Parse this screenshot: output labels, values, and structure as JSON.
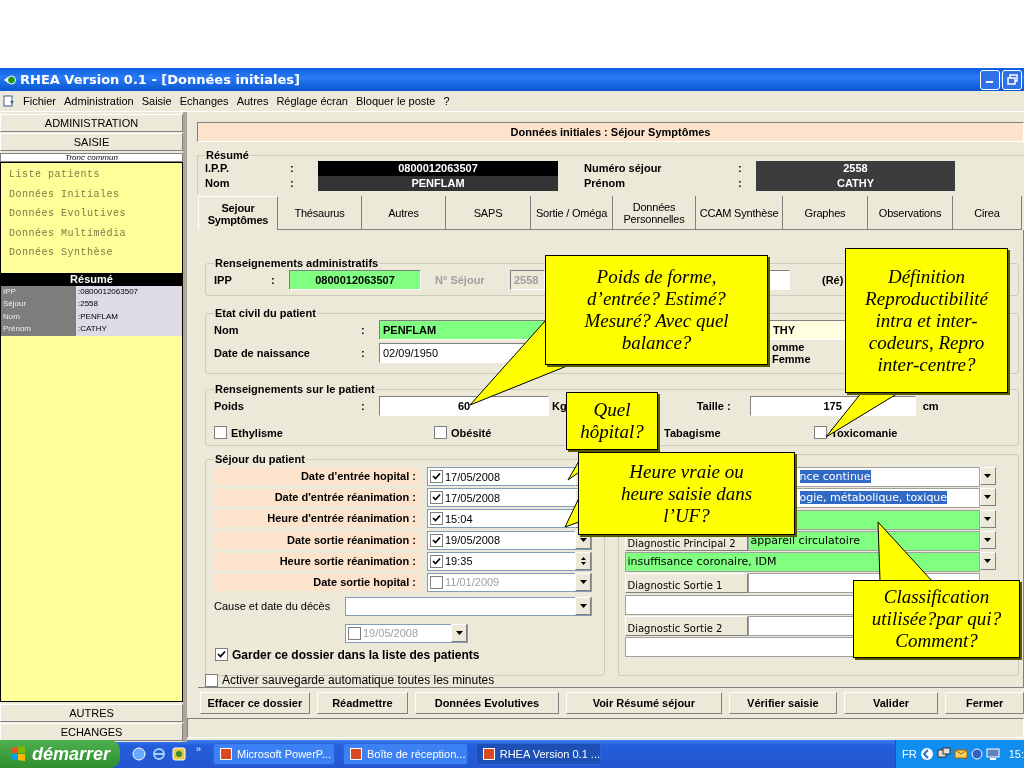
{
  "window": {
    "title": "RHEA Version 0.1 - [Données initiales]"
  },
  "menu": [
    "Fichier",
    "Administration",
    "Saisie",
    "Echanges",
    "Autres",
    "Réglage écran",
    "Bloquer le poste",
    "?"
  ],
  "sidebar": {
    "top_sections": [
      "ADMINISTRATION",
      "SAISIE"
    ],
    "group": "Tronc commun",
    "items": [
      "Liste patients",
      "Données Initiales",
      "Données Evolutives",
      "Données Multimédia",
      "Données Synthèse"
    ],
    "summary": {
      "title": "Résumé",
      "rows": [
        {
          "label": "IPP",
          "value": ":0800012063507"
        },
        {
          "label": "Séjour",
          "value": ":2558"
        },
        {
          "label": "Nom",
          "value": ":PENFLAM"
        },
        {
          "label": "Prénom",
          "value": ":CATHY"
        }
      ]
    },
    "bottom_sections": [
      "AUTRES",
      "ECHANGES"
    ]
  },
  "header": {
    "title": "Données initiales : Séjour Symptômes"
  },
  "summary": {
    "title": "Résumé",
    "fields": [
      {
        "label": "I.P.P.",
        "sep": ":",
        "value": "0800012063507"
      },
      {
        "label": "Nom",
        "sep": ":",
        "value": "PENFLAM"
      },
      {
        "label": "Numéro séjour",
        "sep": ":",
        "value": "2558"
      },
      {
        "label": "Prénom",
        "sep": ":",
        "value": "CATHY"
      }
    ]
  },
  "tabs": [
    {
      "label": "Sejour Symptômes",
      "selected": true
    },
    {
      "label": "Thésaurus",
      "selected": false
    },
    {
      "label": "Autres",
      "selected": false
    },
    {
      "label": "SAPS",
      "selected": false
    },
    {
      "label": "Sortie / Oméga",
      "selected": false
    },
    {
      "label": "Données Personnelles",
      "selected": false
    },
    {
      "label": "CCAM Synthèse",
      "selected": false
    },
    {
      "label": "Graphes",
      "selected": false
    },
    {
      "label": "Observations",
      "selected": false
    },
    {
      "label": "Cirea",
      "selected": false
    }
  ],
  "admin": {
    "title": "Renseignements administratifs",
    "ipp": {
      "label": "IPP",
      "sep": ":",
      "value": "0800012063507"
    },
    "stay": {
      "label": "N° Séjour",
      "value": "2558"
    },
    "re_label": "(Ré)"
  },
  "civil": {
    "title": "Etat civil du patient",
    "name": {
      "label": "Nom",
      "sep": ":",
      "value": "PENFLAM"
    },
    "first_name": "THY",
    "birth": {
      "label": "Date de naissance",
      "sep": ":",
      "value": "02/09/1950"
    },
    "sex": [
      "omme",
      "Femme"
    ]
  },
  "patient": {
    "title": "Renseignements sur le patient",
    "weight": {
      "label": "Poids",
      "sep": ":",
      "value": "60",
      "unit": "Kg"
    },
    "height": {
      "label": "Taille :",
      "value": "175",
      "unit": "cm"
    },
    "conditions": [
      {
        "label": "Ethylisme",
        "checked": false
      },
      {
        "label": "Obésité",
        "checked": false
      },
      {
        "label": "Tabagisme"
      },
      {
        "label": "Toxicomanie",
        "checked": false
      }
    ]
  },
  "stay": {
    "title": "Séjour du patient",
    "rows": [
      {
        "label": "Date d'entrée hopital :",
        "kind": "date",
        "checked": true,
        "value": "17/05/2008"
      },
      {
        "label": "Date d'entrée réanimation :",
        "kind": "date",
        "checked": true,
        "value": "17/05/2008"
      },
      {
        "label": "Heure d'entrée réanimation :",
        "kind": "time",
        "checked": true,
        "value": "15:04"
      },
      {
        "label": "Date sortie réanimation :",
        "kind": "date",
        "checked": true,
        "value": "19/05/2008"
      },
      {
        "label": "Heure sortie réanimation :",
        "kind": "time",
        "checked": true,
        "value": "19:35"
      },
      {
        "label": "Date sortie hopital :",
        "kind": "date",
        "checked": false,
        "value": "11/01/2009"
      }
    ],
    "death": {
      "label": "Cause et date du décès",
      "date": {
        "checked": false,
        "value": "19/05/2008"
      }
    },
    "keep": {
      "label": "Garder ce dossier dans la liste des patients",
      "checked": true
    }
  },
  "autosave": {
    "label": "Activer sauvegarde automatique toutes les minutes",
    "checked": false
  },
  "diagnostics": [
    {
      "value": "nce continue",
      "highlighted": true,
      "color": "#ffffff"
    },
    {
      "value": "ogie, métabolique, toxique",
      "highlighted": true,
      "color": "#ffffff"
    },
    {
      "color": "#80ff80"
    },
    {
      "label": "Diagnostic Principal 2",
      "value": "appareil circulatoire",
      "highlighted": false,
      "color": "#80ff80"
    },
    {
      "value": "insuffisance coronaire, IDM",
      "highlighted": false,
      "color": "#80ff80"
    },
    {
      "label": "Diagnostic Sortie 1",
      "color": "#ffffff"
    },
    {
      "color": "#ffffff"
    },
    {
      "label": "Diagnostic Sortie 2",
      "color": "#ffffff"
    },
    {
      "color": "#ffffff"
    }
  ],
  "buttons": [
    "Effacer ce dossier",
    "Réadmettre",
    "Données Evolutives",
    "Voir Résumé séjour",
    "Vérifier saisie",
    "Valider",
    "Fermer"
  ],
  "taskbar": {
    "start": "démarrer",
    "more": "»",
    "tasks": [
      {
        "label": "Microsoft PowerP...",
        "selected": false
      },
      {
        "label": "Boîte de réception...",
        "selected": false
      },
      {
        "label": "RHEA Version 0.1 ...",
        "selected": true
      }
    ],
    "language": "FR",
    "clock": "15:"
  },
  "callouts": [
    {
      "text": "Poids de forme, d’entrée? Estimé? Mesuré? Avec quel balance?"
    },
    {
      "text": "Définition Reproductibilité intra et inter-codeurs, Repro inter-centre?"
    },
    {
      "text": "Quel hôpital?"
    },
    {
      "text": "Heure vraie ou heure saisie dans l’UF?"
    },
    {
      "text": "Classification utilisée?par qui? Comment?"
    }
  ]
}
